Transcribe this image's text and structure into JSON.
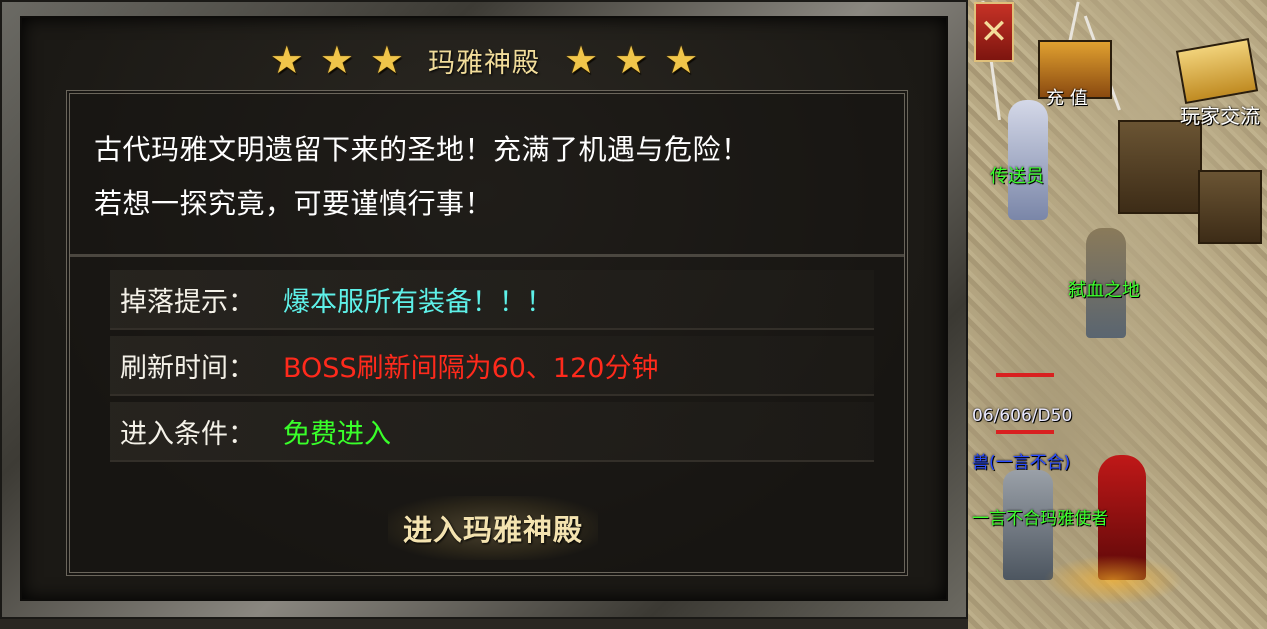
{
  "dialog": {
    "title": "玛雅神殿",
    "stars_left": [
      "★",
      "★",
      "★"
    ],
    "stars_right": [
      "★",
      "★",
      "★"
    ],
    "description": [
      "古代玛雅文明遗留下来的圣地！充满了机遇与危险！",
      "若想一探究竟，可要谨慎行事！"
    ],
    "rows": [
      {
        "label": "掉落提示：",
        "value": "爆本服所有装备！！！",
        "color": "#5ef0e8"
      },
      {
        "label": "刷新时间：",
        "value": "BOSS刷新间隔为60、120分钟",
        "color": "#ff2a1c"
      },
      {
        "label": "进入条件：",
        "value": "免费进入",
        "color": "#39ff2a"
      }
    ],
    "enter_button": "进入玛雅神殿",
    "close_glyph": "✕"
  },
  "world": {
    "recharge_label": "充 值",
    "trade_label": "玩家交流",
    "teleporter_name": "传送员",
    "arena_name": "弑血之地",
    "player_stats": "06/606/D50",
    "guild_text": "兽(一言不合)",
    "npc_line": "一言不合玛雅使者"
  }
}
